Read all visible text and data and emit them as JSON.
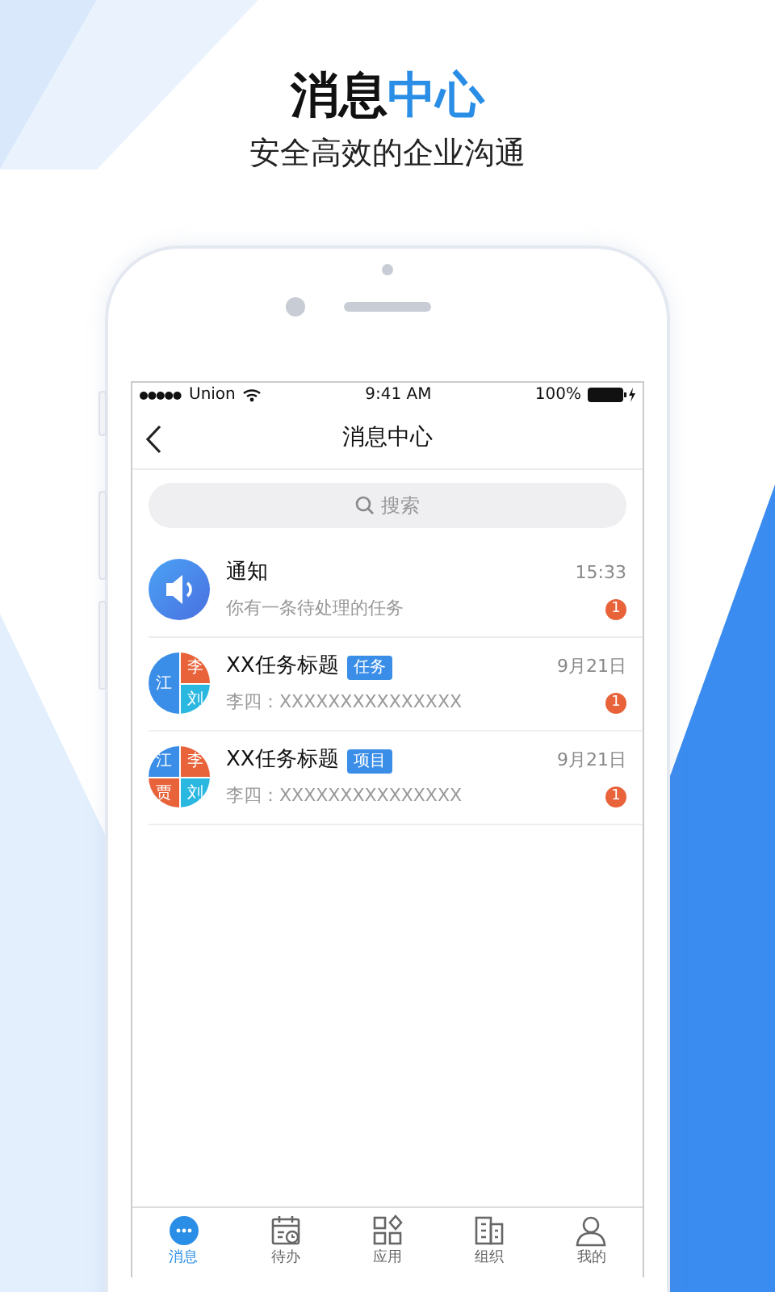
{
  "promo": {
    "title": "消息",
    "title_accent": "中心",
    "subtitle": "安全高效的企业沟通"
  },
  "status_bar": {
    "carrier": "Union",
    "time": "9:41 AM",
    "battery": "100%"
  },
  "nav": {
    "title": "消息中心"
  },
  "search": {
    "placeholder": "搜索"
  },
  "messages": [
    {
      "kind": "notice",
      "title": "通知",
      "preview": "你有一条待处理的任务",
      "time": "15:33",
      "badge": "1"
    },
    {
      "kind": "group",
      "title": "XX任务标题",
      "tag": "任务",
      "preview": "李四：XXXXXXXXXXXXXXX",
      "time": "9月21日",
      "badge": "1",
      "members": [
        {
          "name": "江",
          "color": "#3a8ee8"
        },
        {
          "name": "李",
          "color": "#e8623a"
        },
        {
          "name": "刘",
          "color": "#2bb8e0"
        }
      ]
    },
    {
      "kind": "group",
      "title": "XX任务标题",
      "tag": "项目",
      "preview": "李四：XXXXXXXXXXXXXXX",
      "time": "9月21日",
      "badge": "1",
      "members": [
        {
          "name": "江",
          "color": "#3a8ee8"
        },
        {
          "name": "李",
          "color": "#e8623a"
        },
        {
          "name": "贾",
          "color": "#e8623a"
        },
        {
          "name": "刘",
          "color": "#2bb8e0"
        }
      ]
    }
  ],
  "tabs": [
    {
      "kind": "chat",
      "label": "消息",
      "selected": true
    },
    {
      "kind": "calendar",
      "label": "待办",
      "selected": false
    },
    {
      "kind": "apps",
      "label": "应用",
      "selected": false
    },
    {
      "kind": "org",
      "label": "组织",
      "selected": false
    },
    {
      "kind": "person",
      "label": "我的",
      "selected": false
    }
  ]
}
